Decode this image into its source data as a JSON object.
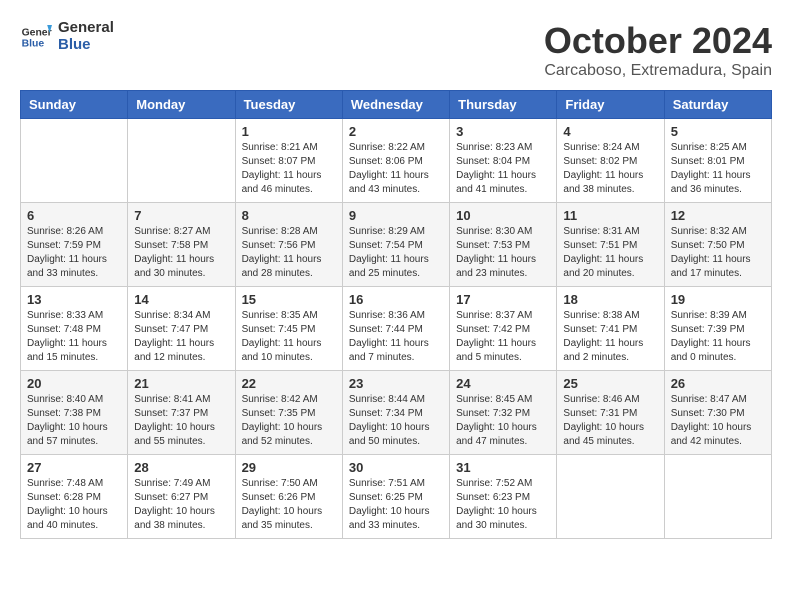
{
  "header": {
    "logo_general": "General",
    "logo_blue": "Blue",
    "month": "October 2024",
    "location": "Carcaboso, Extremadura, Spain"
  },
  "days_of_week": [
    "Sunday",
    "Monday",
    "Tuesday",
    "Wednesday",
    "Thursday",
    "Friday",
    "Saturday"
  ],
  "weeks": [
    [
      {
        "day": "",
        "info": ""
      },
      {
        "day": "",
        "info": ""
      },
      {
        "day": "1",
        "info": "Sunrise: 8:21 AM\nSunset: 8:07 PM\nDaylight: 11 hours and 46 minutes."
      },
      {
        "day": "2",
        "info": "Sunrise: 8:22 AM\nSunset: 8:06 PM\nDaylight: 11 hours and 43 minutes."
      },
      {
        "day": "3",
        "info": "Sunrise: 8:23 AM\nSunset: 8:04 PM\nDaylight: 11 hours and 41 minutes."
      },
      {
        "day": "4",
        "info": "Sunrise: 8:24 AM\nSunset: 8:02 PM\nDaylight: 11 hours and 38 minutes."
      },
      {
        "day": "5",
        "info": "Sunrise: 8:25 AM\nSunset: 8:01 PM\nDaylight: 11 hours and 36 minutes."
      }
    ],
    [
      {
        "day": "6",
        "info": "Sunrise: 8:26 AM\nSunset: 7:59 PM\nDaylight: 11 hours and 33 minutes."
      },
      {
        "day": "7",
        "info": "Sunrise: 8:27 AM\nSunset: 7:58 PM\nDaylight: 11 hours and 30 minutes."
      },
      {
        "day": "8",
        "info": "Sunrise: 8:28 AM\nSunset: 7:56 PM\nDaylight: 11 hours and 28 minutes."
      },
      {
        "day": "9",
        "info": "Sunrise: 8:29 AM\nSunset: 7:54 PM\nDaylight: 11 hours and 25 minutes."
      },
      {
        "day": "10",
        "info": "Sunrise: 8:30 AM\nSunset: 7:53 PM\nDaylight: 11 hours and 23 minutes."
      },
      {
        "day": "11",
        "info": "Sunrise: 8:31 AM\nSunset: 7:51 PM\nDaylight: 11 hours and 20 minutes."
      },
      {
        "day": "12",
        "info": "Sunrise: 8:32 AM\nSunset: 7:50 PM\nDaylight: 11 hours and 17 minutes."
      }
    ],
    [
      {
        "day": "13",
        "info": "Sunrise: 8:33 AM\nSunset: 7:48 PM\nDaylight: 11 hours and 15 minutes."
      },
      {
        "day": "14",
        "info": "Sunrise: 8:34 AM\nSunset: 7:47 PM\nDaylight: 11 hours and 12 minutes."
      },
      {
        "day": "15",
        "info": "Sunrise: 8:35 AM\nSunset: 7:45 PM\nDaylight: 11 hours and 10 minutes."
      },
      {
        "day": "16",
        "info": "Sunrise: 8:36 AM\nSunset: 7:44 PM\nDaylight: 11 hours and 7 minutes."
      },
      {
        "day": "17",
        "info": "Sunrise: 8:37 AM\nSunset: 7:42 PM\nDaylight: 11 hours and 5 minutes."
      },
      {
        "day": "18",
        "info": "Sunrise: 8:38 AM\nSunset: 7:41 PM\nDaylight: 11 hours and 2 minutes."
      },
      {
        "day": "19",
        "info": "Sunrise: 8:39 AM\nSunset: 7:39 PM\nDaylight: 11 hours and 0 minutes."
      }
    ],
    [
      {
        "day": "20",
        "info": "Sunrise: 8:40 AM\nSunset: 7:38 PM\nDaylight: 10 hours and 57 minutes."
      },
      {
        "day": "21",
        "info": "Sunrise: 8:41 AM\nSunset: 7:37 PM\nDaylight: 10 hours and 55 minutes."
      },
      {
        "day": "22",
        "info": "Sunrise: 8:42 AM\nSunset: 7:35 PM\nDaylight: 10 hours and 52 minutes."
      },
      {
        "day": "23",
        "info": "Sunrise: 8:44 AM\nSunset: 7:34 PM\nDaylight: 10 hours and 50 minutes."
      },
      {
        "day": "24",
        "info": "Sunrise: 8:45 AM\nSunset: 7:32 PM\nDaylight: 10 hours and 47 minutes."
      },
      {
        "day": "25",
        "info": "Sunrise: 8:46 AM\nSunset: 7:31 PM\nDaylight: 10 hours and 45 minutes."
      },
      {
        "day": "26",
        "info": "Sunrise: 8:47 AM\nSunset: 7:30 PM\nDaylight: 10 hours and 42 minutes."
      }
    ],
    [
      {
        "day": "27",
        "info": "Sunrise: 7:48 AM\nSunset: 6:28 PM\nDaylight: 10 hours and 40 minutes."
      },
      {
        "day": "28",
        "info": "Sunrise: 7:49 AM\nSunset: 6:27 PM\nDaylight: 10 hours and 38 minutes."
      },
      {
        "day": "29",
        "info": "Sunrise: 7:50 AM\nSunset: 6:26 PM\nDaylight: 10 hours and 35 minutes."
      },
      {
        "day": "30",
        "info": "Sunrise: 7:51 AM\nSunset: 6:25 PM\nDaylight: 10 hours and 33 minutes."
      },
      {
        "day": "31",
        "info": "Sunrise: 7:52 AM\nSunset: 6:23 PM\nDaylight: 10 hours and 30 minutes."
      },
      {
        "day": "",
        "info": ""
      },
      {
        "day": "",
        "info": ""
      }
    ]
  ]
}
